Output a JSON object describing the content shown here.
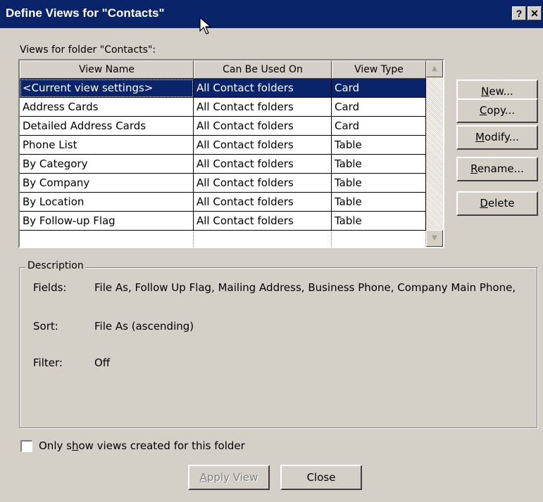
{
  "window": {
    "title": "Define Views for \"Contacts\"",
    "help_label": "?",
    "close_label": "✕"
  },
  "views_label": "Views for folder \"Contacts\":",
  "table": {
    "columns": [
      "View Name",
      "Can Be Used On",
      "View Type"
    ],
    "rows": [
      [
        "<Current view settings>",
        "All Contact folders",
        "Card"
      ],
      [
        "Address Cards",
        "All Contact folders",
        "Card"
      ],
      [
        "Detailed Address Cards",
        "All Contact folders",
        "Card"
      ],
      [
        "Phone List",
        "All Contact folders",
        "Table"
      ],
      [
        "By Category",
        "All Contact folders",
        "Table"
      ],
      [
        "By Company",
        "All Contact folders",
        "Table"
      ],
      [
        "By Location",
        "All Contact folders",
        "Table"
      ],
      [
        "By Follow-up Flag",
        "All Contact folders",
        "Table"
      ]
    ],
    "selected_row": 0
  },
  "buttons": {
    "new": {
      "pre": "",
      "u": "N",
      "post": "ew..."
    },
    "copy": {
      "pre": "",
      "u": "C",
      "post": "opy..."
    },
    "modify": {
      "pre": "",
      "u": "M",
      "post": "odify..."
    },
    "rename": {
      "pre": "",
      "u": "R",
      "post": "ename..."
    },
    "delete": {
      "pre": "",
      "u": "D",
      "post": "elete"
    }
  },
  "description": {
    "title": "Description",
    "fields_label": "Fields:",
    "fields_value": "File As, Follow Up Flag, Mailing Address, Business Phone, Company Main Phone,",
    "sort_label": "Sort:",
    "sort_value": "File As (ascending)",
    "filter_label": "Filter:",
    "filter_value": "Off"
  },
  "only_show": {
    "pre": "Only s",
    "u": "h",
    "post": "ow views created for this folder",
    "checked": false
  },
  "footer": {
    "apply": {
      "pre": "",
      "u": "A",
      "post": "pply View",
      "enabled": false
    },
    "close_label": "Close"
  },
  "colors": {
    "titlebar": "#0a246a",
    "selection": "#0a246a",
    "dialog_bg": "#d4d0c8"
  }
}
